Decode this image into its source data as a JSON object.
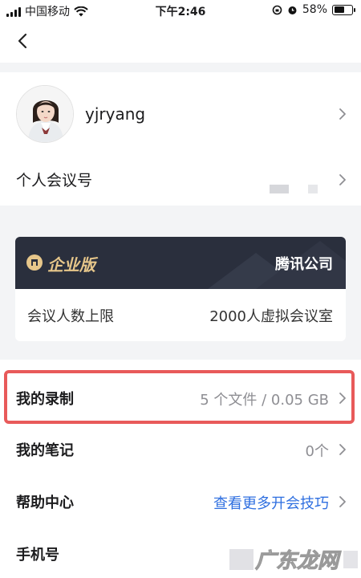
{
  "status_bar": {
    "carrier": "中国移动",
    "time": "下午2:46",
    "battery_percent": "58%",
    "battery_level": 0.58,
    "icons": [
      "signal-icon",
      "wifi-icon",
      "rotation-lock-icon",
      "alarm-icon",
      "battery-icon"
    ]
  },
  "nav": {
    "back_icon": "chevron-left-icon"
  },
  "profile": {
    "username": "yjryang",
    "personal_meeting_label": "个人会议号"
  },
  "enterprise": {
    "badge": "企业版",
    "company": "腾讯公司",
    "quota_label": "会议人数上限",
    "quota_value": "2000人虚拟会议室",
    "badge_color": "#e6c68a",
    "header_color": "#2a2f3d"
  },
  "menu": [
    {
      "label": "我的录制",
      "value": "5 个文件 / 0.05 GB"
    },
    {
      "label": "我的笔记",
      "value": "0个"
    },
    {
      "label": "帮助中心",
      "value": "查看更多开会技巧"
    },
    {
      "label": "手机号",
      "value": ""
    }
  ],
  "watermark": {
    "text": "广东龙网"
  },
  "colors": {
    "accent_link": "#2f6fe0",
    "highlight": "#e85a5a"
  }
}
